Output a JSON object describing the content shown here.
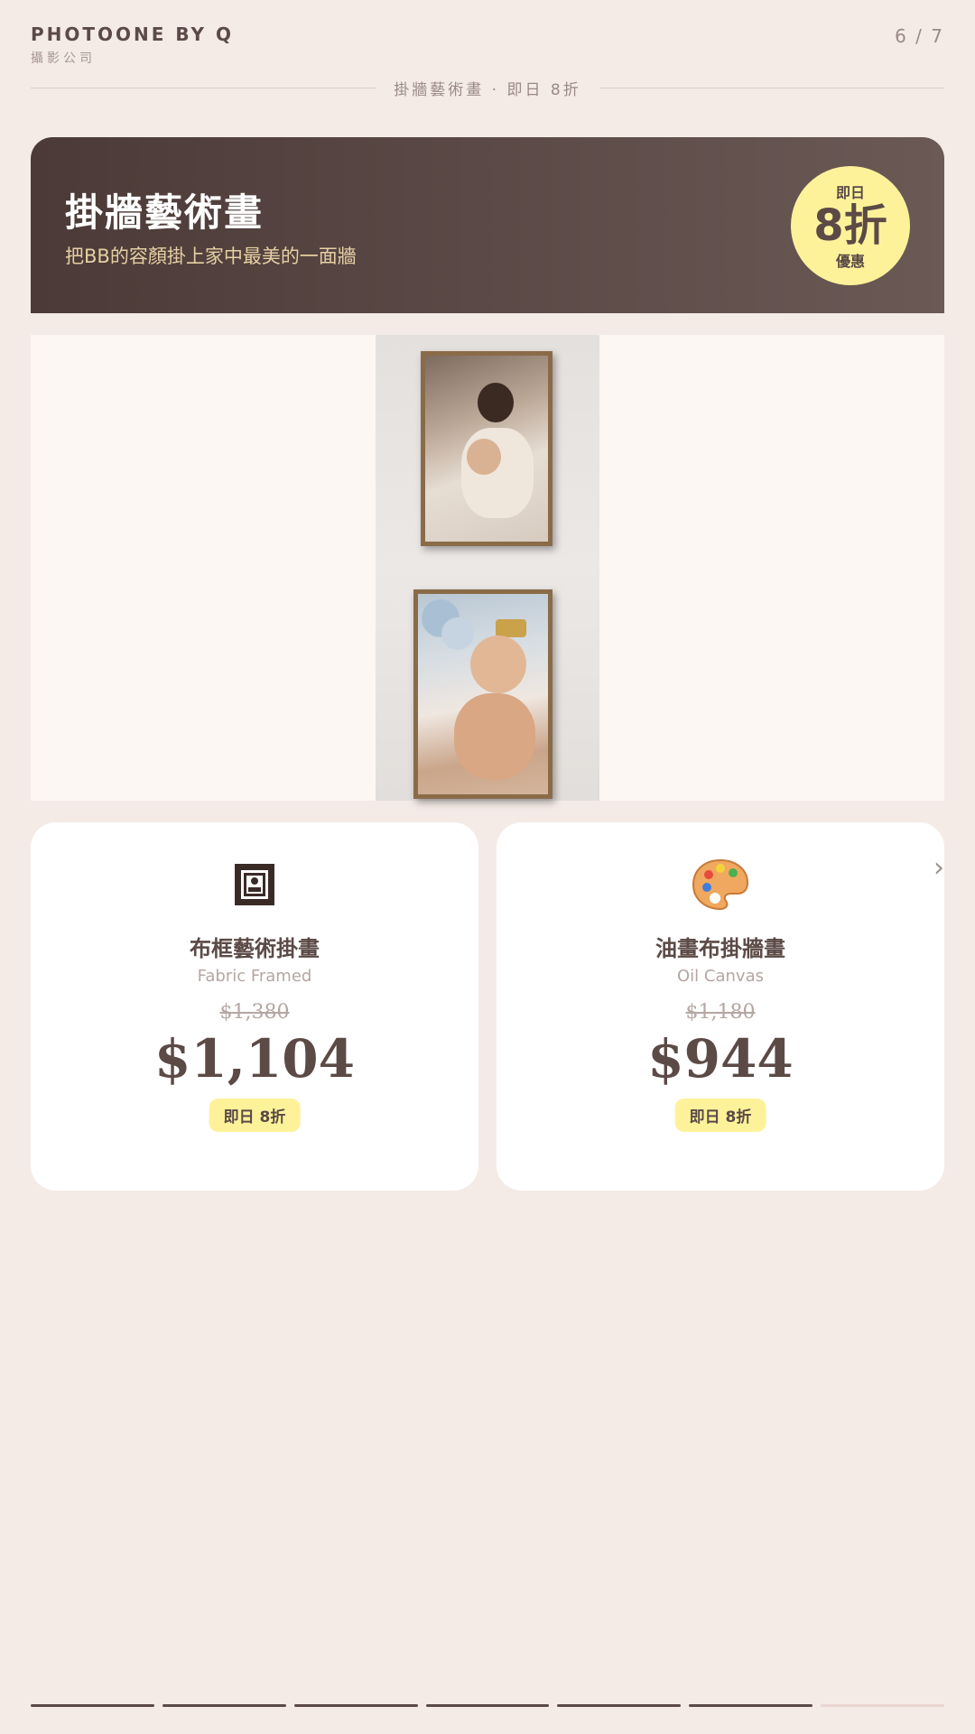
{
  "header": {
    "brand_name": "PHOTOONE BY Q",
    "brand_sub": "攝影公司",
    "page_indicator": "6 / 7",
    "subtitle": "掛牆藝術畫 · 即日 8折"
  },
  "banner": {
    "title": "掛牆藝術畫",
    "description": "把BB的容顏掛上家中最美的一面牆",
    "badge_top": "即日",
    "badge_big": "8折",
    "badge_bottom": "優惠"
  },
  "products": [
    {
      "icon": "framed-picture-icon",
      "title": "布框藝術掛畫",
      "subtitle": "Fabric Framed",
      "old_price": "$1,380",
      "price": "$1,104",
      "tag": "即日 8折"
    },
    {
      "icon": "palette-icon",
      "title": "油畫布掛牆畫",
      "subtitle": "Oil Canvas",
      "old_price": "$1,180",
      "price": "$944",
      "tag": "即日 8折"
    }
  ],
  "progress": {
    "total": 7,
    "completed": 6
  },
  "colors": {
    "background": "#f4ebe6",
    "accent_dark": "#5b4a46",
    "badge_yellow": "#fdf29a",
    "banner_text": "#e6cfa3"
  }
}
